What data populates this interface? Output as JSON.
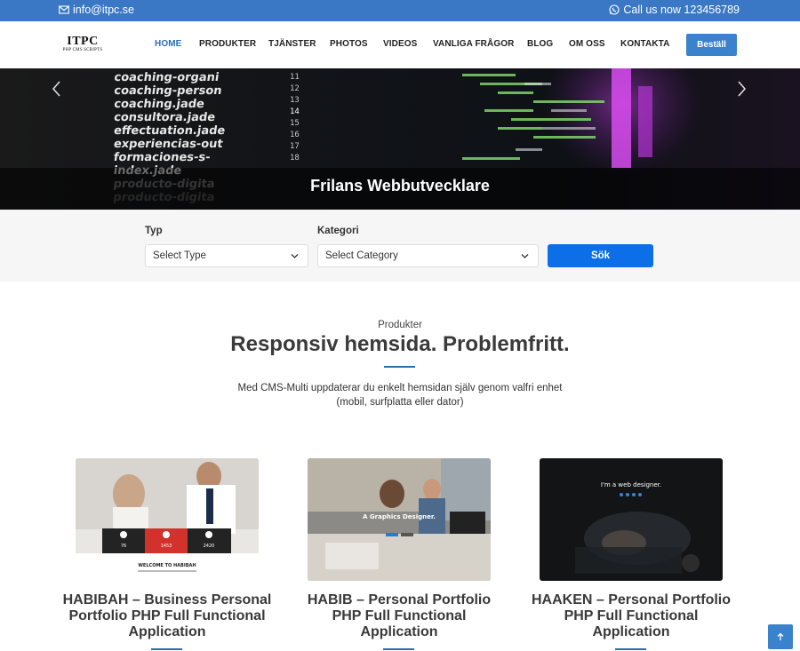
{
  "topbar": {
    "email": "info@itpc.se",
    "phone": "Call us now 123456789"
  },
  "logo": {
    "line1": "ITPC",
    "line2": "PHP CMS SCRIPTS"
  },
  "nav": {
    "items": [
      {
        "label": "HOME",
        "active": true
      },
      {
        "label": "PRODUKTER"
      },
      {
        "label": "TJÄNSTER"
      },
      {
        "label": "PHOTOS"
      },
      {
        "label": "VIDEOS"
      },
      {
        "label": "VANLIGA FRÅGOR"
      },
      {
        "label": "BLOG"
      },
      {
        "label": "OM OSS"
      },
      {
        "label": "KONTAKTA"
      }
    ],
    "order_label": "Beställ"
  },
  "hero": {
    "caption": "Frilans Webbutvecklare",
    "code_words": [
      "coaching-organi",
      "coaching-person",
      "coaching.jade",
      "consultora.jade",
      "effectuation.jade",
      "experiencias-out",
      "formaciones-s-",
      "index.jade",
      "producto-digita",
      "producto-digita"
    ],
    "line_numbers": [
      "11",
      "12",
      "13",
      "14",
      "15",
      "16",
      "17",
      "18"
    ]
  },
  "search": {
    "type_label": "Typ",
    "type_value": "Select Type",
    "category_label": "Kategori",
    "category_value": "Select Category",
    "submit_label": "Sök"
  },
  "section": {
    "subtitle": "Produkter",
    "title": "Responsiv hemsida. Problemfritt.",
    "description": "Med CMS-Multi uppdaterar du enkelt hemsidan själv genom valfri enhet (mobil, surfplatta eller dator)"
  },
  "products": [
    {
      "title": "HABIBAH – Business Personal Portfolio PHP Full Functional Application",
      "thumb_text": "WELCOME TO HABIBAH",
      "stats": [
        "76",
        "1453",
        "2420"
      ]
    },
    {
      "title": "HABIB – Personal Portfolio PHP Full Functional Application",
      "thumb_text": "A Graphics Designer."
    },
    {
      "title": "HAAKEN – Personal Portfolio PHP Full Functional Application",
      "thumb_text": "I'm a web designer."
    }
  ],
  "colors": {
    "topbar": "#3a78c6",
    "accent": "#2e6db1",
    "search_button": "#0d6fe8"
  },
  "icons": {
    "email": "envelope-icon",
    "phone": "whatsapp-icon",
    "prev": "chevron-left-icon",
    "next": "chevron-right-icon",
    "select": "chevron-down-icon",
    "scroll": "arrow-up-icon"
  }
}
